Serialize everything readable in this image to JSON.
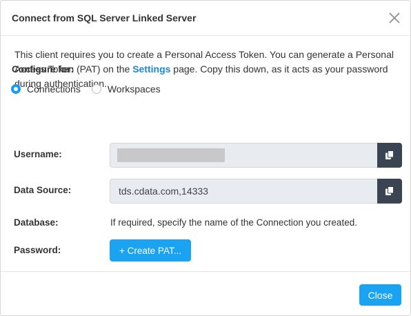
{
  "dialog": {
    "title": "Connect from SQL Server Linked Server",
    "close_icon": "close-icon"
  },
  "intro": {
    "text_before": "This client requires you to create a Personal Access Token. You can generate a Personal Access Token (PAT) on the ",
    "link_text": "Settings",
    "text_after": " page. Copy this down, as it acts as your password during authentication."
  },
  "configure": {
    "label": "Configure for:",
    "options": [
      {
        "label": "Connections",
        "selected": true
      },
      {
        "label": "Workspaces",
        "selected": false
      }
    ]
  },
  "fields": {
    "username": {
      "label": "Username:",
      "value_redacted": true,
      "copy_icon": "copy-icon"
    },
    "data_source": {
      "label": "Data Source:",
      "value": "tds.cdata.com,14333",
      "copy_icon": "copy-icon"
    },
    "database": {
      "label": "Database:",
      "value": "If required, specify the name of the Connection you created."
    },
    "password": {
      "label": "Password:",
      "button_label": "+ Create PAT..."
    }
  },
  "footer": {
    "close_label": "Close"
  },
  "colors": {
    "accent": "#1aa3f0",
    "link": "#1a87d6",
    "copy_button": "#3a4452",
    "field_bg": "#e8ebef"
  }
}
